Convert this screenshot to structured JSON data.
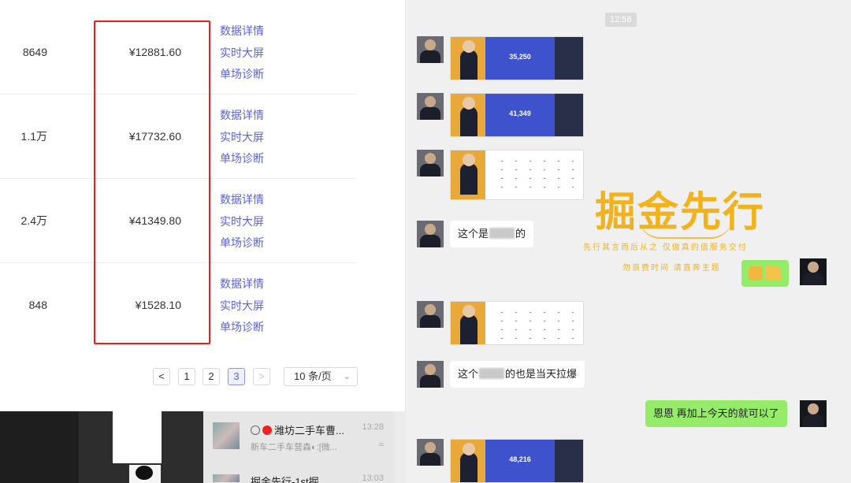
{
  "table": {
    "rows": [
      {
        "count": "8649",
        "amount": "¥12881.60"
      },
      {
        "count": "1.1万",
        "amount": "¥17732.60"
      },
      {
        "count": "2.4万",
        "amount": "¥41349.80"
      },
      {
        "count": "848",
        "amount": "¥1528.10"
      }
    ],
    "links": {
      "detail": "数据详情",
      "realtime": "实时大屏",
      "diagnosis": "单场诊断"
    }
  },
  "pagination": {
    "prev": "<",
    "next": ">",
    "pages": [
      "1",
      "2",
      "3"
    ],
    "current_page": "3",
    "page_size": "10 条/页"
  },
  "sessions": [
    {
      "title": "潍坊二手车曹...",
      "time": "13:28",
      "subtitle": "新车二手车营森◐:[微..."
    },
    {
      "title": "掘金先行-1st掘",
      "time": "13:03"
    }
  ],
  "chat": {
    "timestamp": "12:58",
    "cards": [
      {
        "number": "35,250"
      },
      {
        "number": "41,349"
      },
      {
        "number": ""
      },
      {
        "number": ""
      },
      {
        "number": "48,216"
      }
    ],
    "msg_1_prefix": "这个是",
    "msg_1_suffix": "的",
    "msg_2_prefix": "这个",
    "msg_2_suffix": "的也是当天拉爆",
    "msg_3": "恩恩 再加上今天的就可以了"
  },
  "watermark": {
    "title": "掘金先行",
    "line1": "先行其言而后从之 仅做真的值服务交付",
    "line2": "勿浪费时间 请直奔主题"
  },
  "colors": {
    "link": "#5a63d8",
    "highlight": "#e32121",
    "bubble_green": "#95ec69",
    "brand_gold": "#f2b21c"
  }
}
